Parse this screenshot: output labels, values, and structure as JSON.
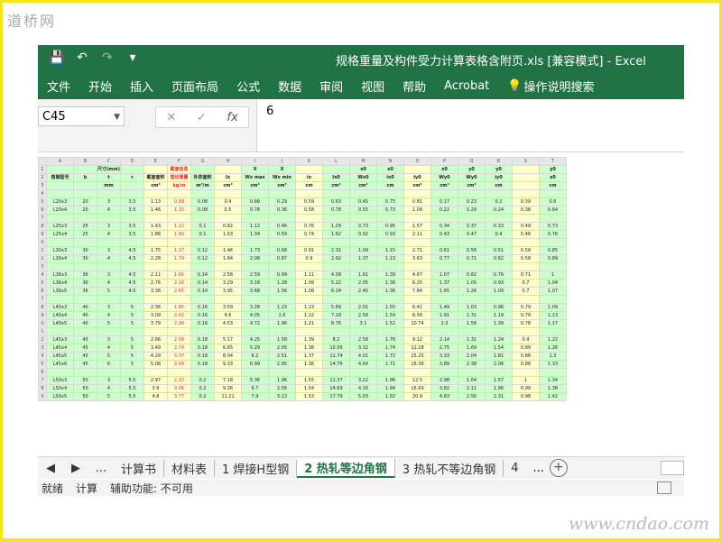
{
  "watermark": {
    "top": "道桥网",
    "bottom": "www.cndao.com"
  },
  "window": {
    "doc_title": "规格重量及构件受力计算表格含附页.xls  [兼容模式]  -  Excel"
  },
  "quick_access": {
    "save_icon": "💾",
    "undo_icon": "↶",
    "redo_icon": "↷",
    "customize_icon": "▾"
  },
  "menu": {
    "items": [
      "文件",
      "开始",
      "插入",
      "页面布局",
      "公式",
      "数据",
      "审阅",
      "视图",
      "帮助",
      "Acrobat"
    ],
    "tell_me": "操作说明搜索",
    "bulb_icon": "💡"
  },
  "formula_bar": {
    "name_box": "C45",
    "cancel": "✕",
    "enter": "✓",
    "fx": "fx",
    "value": "6"
  },
  "columns": [
    "A",
    "B",
    "C",
    "D",
    "E",
    "F",
    "G",
    "H",
    "I",
    "J",
    "K",
    "L",
    "M",
    "N",
    "O",
    "P",
    "Q",
    "R",
    "S",
    "T"
  ],
  "header_rows": {
    "r1": [
      "",
      "",
      "尺寸(mm)",
      "",
      "",
      "截面信息",
      "",
      "",
      "X",
      "X",
      "",
      "",
      "x0",
      "x0",
      "",
      "x0",
      "y0",
      "y0",
      "",
      "y0"
    ],
    "r2": [
      "角钢型号",
      "b",
      "t",
      "r",
      "截面面积",
      "理论重量",
      "外表面积",
      "Ix",
      "Wx max",
      "Wx min",
      "ix",
      "Ix0",
      "Wx0",
      "ix0",
      "Iy0",
      "Wy0",
      "Wy0",
      "iy0",
      "",
      "z0"
    ],
    "r3": [
      "",
      "",
      "mm",
      "",
      "cm²",
      "kg/m",
      "m²/m",
      "cm⁴",
      "cm³",
      "cm³",
      "cm",
      "cm⁴",
      "cm³",
      "cm",
      "cm⁴",
      "cm³",
      "cm³",
      "cm",
      "",
      "cm"
    ]
  },
  "table_rows": [
    [
      "L20x3",
      "20",
      "3",
      "3.5",
      "1.13",
      "0.89",
      "0.08",
      "0.4",
      "0.66",
      "0.29",
      "0.59",
      "0.63",
      "0.45",
      "0.75",
      "0.81",
      "0.17",
      "0.23",
      "0.2",
      "0.39",
      "0.6"
    ],
    [
      "L20x4",
      "20",
      "4",
      "3.5",
      "1.46",
      "1.15",
      "0.08",
      "0.5",
      "0.78",
      "0.36",
      "0.58",
      "0.78",
      "0.55",
      "0.73",
      "1.09",
      "0.22",
      "0.29",
      "0.24",
      "0.38",
      "0.64"
    ],
    [],
    [
      "L25x3",
      "25",
      "3",
      "3.5",
      "1.43",
      "1.12",
      "0.1",
      "0.82",
      "1.12",
      "0.46",
      "0.76",
      "1.29",
      "0.73",
      "0.95",
      "1.57",
      "0.34",
      "0.37",
      "0.33",
      "0.49",
      "0.73"
    ],
    [
      "L25x4",
      "25",
      "4",
      "3.5",
      "1.86",
      "1.46",
      "0.1",
      "1.03",
      "1.34",
      "0.59",
      "0.74",
      "1.62",
      "0.92",
      "0.93",
      "2.11",
      "0.43",
      "0.47",
      "0.4",
      "0.48",
      "0.76"
    ],
    [],
    [
      "L30x3",
      "30",
      "3",
      "4.5",
      "1.75",
      "1.37",
      "0.12",
      "1.46",
      "1.73",
      "0.68",
      "0.91",
      "2.31",
      "1.09",
      "1.15",
      "2.71",
      "0.61",
      "0.56",
      "0.51",
      "0.59",
      "0.85"
    ],
    [
      "L30x4",
      "30",
      "4",
      "4.5",
      "2.28",
      "1.79",
      "0.12",
      "1.84",
      "2.08",
      "0.87",
      "0.9",
      "2.92",
      "1.37",
      "1.13",
      "3.63",
      "0.77",
      "0.71",
      "0.62",
      "0.58",
      "0.89"
    ],
    [],
    [
      "L36x3",
      "36",
      "3",
      "4.5",
      "2.11",
      "1.66",
      "0.14",
      "2.58",
      "2.59",
      "0.99",
      "1.11",
      "4.09",
      "1.61",
      "1.39",
      "4.67",
      "1.07",
      "0.82",
      "0.76",
      "0.71",
      "1"
    ],
    [
      "L36x4",
      "36",
      "4",
      "4.5",
      "2.76",
      "2.16",
      "0.14",
      "3.29",
      "3.18",
      "1.28",
      "1.09",
      "5.22",
      "2.05",
      "1.38",
      "6.25",
      "1.37",
      "1.05",
      "0.93",
      "0.7",
      "1.04"
    ],
    [
      "L36x5",
      "36",
      "5",
      "4.5",
      "3.38",
      "2.65",
      "0.14",
      "3.95",
      "3.68",
      "1.56",
      "1.08",
      "6.24",
      "2.45",
      "1.36",
      "7.84",
      "1.65",
      "1.26",
      "1.09",
      "0.7",
      "1.07"
    ],
    [],
    [
      "L40x3",
      "40",
      "3",
      "5",
      "2.36",
      "1.85",
      "0.16",
      "3.59",
      "3.28",
      "1.23",
      "1.23",
      "5.69",
      "2.01",
      "1.55",
      "6.41",
      "1.49",
      "1.03",
      "0.96",
      "0.79",
      "1.09"
    ],
    [
      "L40x4",
      "40",
      "4",
      "5",
      "3.09",
      "2.42",
      "0.16",
      "4.6",
      "4.05",
      "1.6",
      "1.22",
      "7.29",
      "2.58",
      "1.54",
      "8.56",
      "1.91",
      "1.31",
      "1.19",
      "0.79",
      "1.13"
    ],
    [
      "L40x5",
      "40",
      "5",
      "5",
      "3.79",
      "2.98",
      "0.16",
      "4.53",
      "4.72",
      "1.96",
      "1.21",
      "8.76",
      "3.1",
      "1.52",
      "10.74",
      "2.3",
      "1.58",
      "1.39",
      "0.78",
      "1.17"
    ],
    [],
    [
      "L45x3",
      "45",
      "3",
      "5",
      "2.66",
      "2.09",
      "0.18",
      "5.17",
      "4.25",
      "1.58",
      "1.39",
      "8.2",
      "2.58",
      "1.76",
      "9.12",
      "2.14",
      "1.31",
      "1.24",
      "0.9",
      "1.22"
    ],
    [
      "L45x4",
      "45",
      "4",
      "5",
      "3.49",
      "2.74",
      "0.18",
      "6.65",
      "5.29",
      "2.05",
      "1.38",
      "10.56",
      "3.32",
      "1.74",
      "12.18",
      "2.75",
      "1.69",
      "1.54",
      "0.89",
      "1.26"
    ],
    [
      "L45x5",
      "45",
      "5",
      "5",
      "4.29",
      "3.37",
      "0.18",
      "8.04",
      "6.2",
      "2.51",
      "1.37",
      "12.74",
      "4.01",
      "1.72",
      "15.25",
      "3.33",
      "2.04",
      "1.81",
      "0.88",
      "1.3"
    ],
    [
      "L45x6",
      "45",
      "6",
      "5",
      "5.08",
      "3.99",
      "0.18",
      "9.33",
      "6.99",
      "2.95",
      "1.36",
      "14.76",
      "4.64",
      "1.71",
      "18.36",
      "3.89",
      "2.38",
      "2.06",
      "0.88",
      "1.33"
    ],
    [],
    [
      "L50x3",
      "50",
      "3",
      "5.5",
      "2.97",
      "2.33",
      "0.2",
      "7.18",
      "5.36",
      "1.96",
      "1.55",
      "11.37",
      "3.22",
      "1.96",
      "12.5",
      "2.98",
      "1.64",
      "1.57",
      "1",
      "1.34"
    ],
    [
      "L50x4",
      "50",
      "4",
      "5.5",
      "3.9",
      "3.06",
      "0.2",
      "9.26",
      "6.7",
      "2.56",
      "1.54",
      "14.69",
      "4.16",
      "1.94",
      "16.69",
      "3.82",
      "2.11",
      "1.96",
      "0.99",
      "1.38"
    ],
    [
      "L50x5",
      "50",
      "5",
      "5.5",
      "4.8",
      "3.77",
      "0.2",
      "11.21",
      "7.9",
      "3.13",
      "1.53",
      "17.79",
      "5.03",
      "1.92",
      "20.9",
      "4.63",
      "2.56",
      "2.31",
      "0.98",
      "1.42"
    ]
  ],
  "row_numbers": [
    "1",
    "2",
    "3",
    "4",
    "5",
    "6",
    "7",
    "8",
    "9",
    "0",
    "1",
    "2",
    "3",
    "4",
    "5",
    "6",
    "7",
    "8",
    "9",
    "0",
    "1",
    "2",
    "3",
    "4",
    "5",
    "6",
    "7",
    "8",
    "9",
    "0",
    "1",
    "2",
    "3"
  ],
  "sheet_tabs": {
    "prev": "◀",
    "next": "▶",
    "more": "...",
    "tabs": [
      "计算书",
      "材料表",
      "1 焊接H型钢",
      "2 热轧等边角钢",
      "3 热轧不等边角钢",
      "4"
    ],
    "active_index": 3,
    "add": "+",
    "more_right": "..."
  },
  "status": {
    "ready": "就绪",
    "calc": "计算",
    "accessibility": "辅助功能: 不可用"
  }
}
